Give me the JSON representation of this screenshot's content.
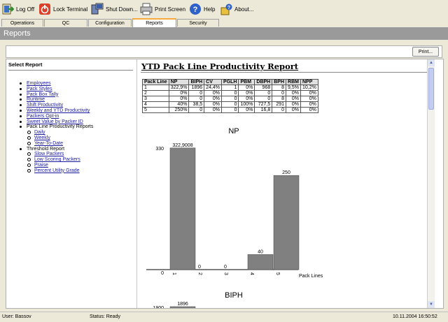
{
  "toolbar": {
    "logoff_label": "Log Off",
    "lock_label": "Lock Terminal",
    "shutdown_label": "Shut Down...",
    "print_screen_label": "Print Screen",
    "help_label": "Help",
    "about_label": "About..."
  },
  "tabs": [
    "Operations",
    "QC",
    "Configuration",
    "Reports",
    "Security"
  ],
  "active_tab": "Reports",
  "page_title": "Reports",
  "print_button": "Print...",
  "select_report": {
    "title": "Select Report",
    "items": [
      "Employees",
      "Pack Styles",
      "Pack Box Tally",
      "Runtime",
      "Shift Productivity",
      "Weekly and YTD Productivity",
      "Packers Opt-in",
      "Sweet Value by Packer ID"
    ],
    "group1": {
      "label": "Pack Line Productivity Reports",
      "items": [
        "Daily",
        "Weekly",
        "Year-To-Date"
      ]
    },
    "group2": {
      "label": "Threshold Report",
      "items": [
        "Slow Packers",
        "Low Scoring Packers",
        "Praise",
        "Percent Utility Grade"
      ]
    }
  },
  "report": {
    "title": "YTD Pack Line Productivity Report",
    "headers": [
      "Pack Line",
      "NP",
      "BIPH",
      "CV",
      "PGLH",
      "PBM",
      "DBPH",
      "BPH",
      "RBM",
      "NPP"
    ],
    "rows": [
      [
        "1",
        "322,9%",
        "1896",
        "24,4%",
        "1",
        "0%",
        "968",
        "8",
        "9,5%",
        "10,2%"
      ],
      [
        "2",
        "0%",
        "0",
        "0%",
        "0",
        "0%",
        "0",
        "0",
        "0%",
        "0%"
      ],
      [
        "3",
        "0%",
        "0",
        "0%",
        "0",
        "0%",
        "0",
        "8",
        "0%",
        "0%"
      ],
      [
        "4",
        "40%",
        "38,5",
        "0%",
        "0",
        "100%",
        "727,5",
        "291",
        "0%",
        "0%"
      ],
      [
        "5",
        "250%",
        "0",
        "0%",
        "0",
        "0%",
        "16,8",
        "0",
        "0%",
        "0%"
      ]
    ]
  },
  "chart_data": [
    {
      "type": "bar",
      "title": "NP",
      "categories": [
        "1",
        "2",
        "3",
        "4",
        "5"
      ],
      "values": [
        322.9008,
        0,
        0,
        40,
        250
      ],
      "value_labels": [
        "322,9008",
        "0",
        "0",
        "40",
        "250"
      ],
      "xlabel": "Pack Lines",
      "y_tick_labels": [
        "330",
        "0"
      ],
      "ylim": [
        0,
        330
      ],
      "bar_color": "#808080"
    },
    {
      "type": "bar",
      "title": "BIPH",
      "categories": [
        "1",
        "2",
        "3",
        "4",
        "5"
      ],
      "visible_value_labels": [
        "1896"
      ],
      "y_tick_labels": [
        "1900"
      ],
      "values": [
        1896
      ]
    }
  ],
  "status": {
    "user": "User: Bassov",
    "status": "Status: Ready",
    "datetime": "10.11.2004 16:50:52"
  },
  "colors": {
    "title_bar": "#9a9a9a",
    "active_tab_accent": "#f6ab3c",
    "link": "#1a1a9e",
    "bar": "#808080"
  }
}
